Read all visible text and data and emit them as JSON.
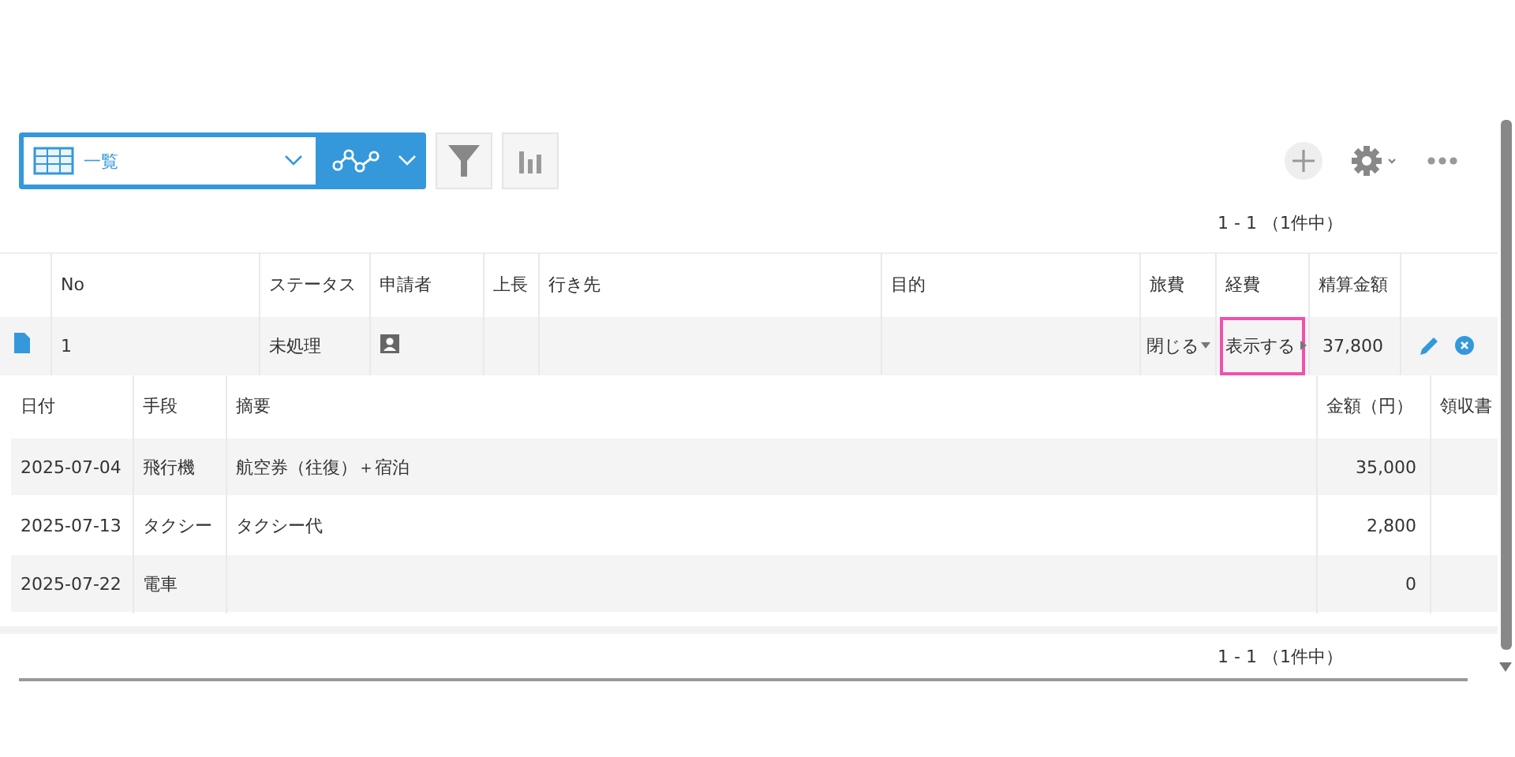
{
  "view_selector": {
    "label": "一覧"
  },
  "pager_top": "1 - 1 （1件中）",
  "table": {
    "columns": [
      "No",
      "ステータス",
      "申請者",
      "上長",
      "行き先",
      "目的",
      "旅費",
      "経費",
      "精算金額"
    ],
    "rows": [
      {
        "no": "1",
        "status": "未処理",
        "travel_toggle": "閉じる",
        "expense_toggle": "表示する",
        "expense_highlighted": true,
        "amount": "37,800"
      }
    ]
  },
  "expenses": {
    "columns": [
      "日付",
      "手段",
      "摘要",
      "金額（円）",
      "領収書"
    ],
    "rows": [
      {
        "date": "2025-07-04",
        "means": "飛行機",
        "summary": "航空券（往復）＋宿泊",
        "amount": "35,000"
      },
      {
        "date": "2025-07-13",
        "means": "タクシー",
        "summary": "タクシー代",
        "amount": "2,800"
      },
      {
        "date": "2025-07-22",
        "means": "電車",
        "amount": "0"
      }
    ]
  },
  "pager_bottom": "1 - 1 （1件中）"
}
